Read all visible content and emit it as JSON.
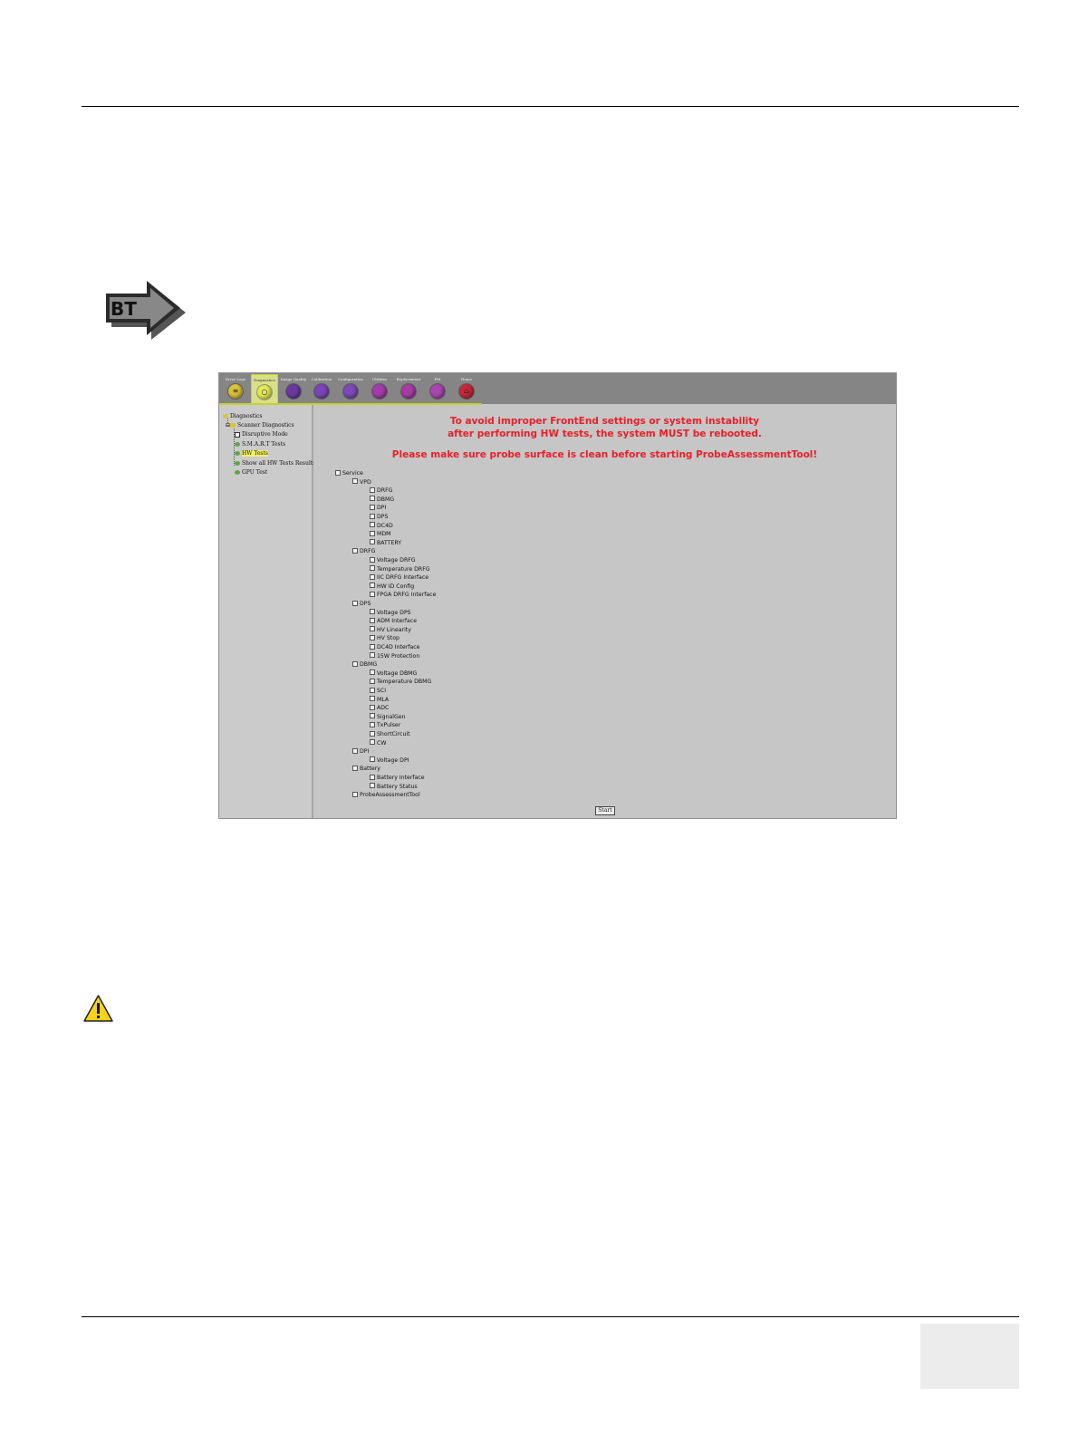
{
  "window": {
    "tabs": [
      {
        "label": "Error Logs",
        "color": "#d9c23a",
        "glyph": "≡"
      },
      {
        "label": "Diagnostics",
        "color": "#e3e85a",
        "glyph": "○"
      },
      {
        "label": "Image Quality",
        "color": "#6a3aa0",
        "glyph": ""
      },
      {
        "label": "Calibration",
        "color": "#7a44b8",
        "glyph": ""
      },
      {
        "label": "Configuration",
        "color": "#7b4ab6",
        "glyph": ""
      },
      {
        "label": "Utilities",
        "color": "#a23ca8",
        "glyph": ""
      },
      {
        "label": "Replacement",
        "color": "#a63ca4",
        "glyph": ""
      },
      {
        "label": "PM",
        "color": "#a845b0",
        "glyph": ""
      },
      {
        "label": "Home",
        "color": "#c8283a",
        "glyph": "⌂"
      }
    ],
    "tree": {
      "root": "Diagnostics",
      "scanner": "Scanner Diagnostics",
      "items": [
        "Disruptive Mode",
        "S.M.A.R.T Tests",
        "HW Tests",
        "Show all HW Tests Results",
        "GPU Test"
      ]
    },
    "warning": {
      "line1": "To avoid improper FrontEnd settings or system instability",
      "line2": "after performing HW tests, the system MUST be rebooted.",
      "line3": "Please make sure probe surface is clean before starting ProbeAssessmentTool!"
    },
    "checklist": [
      {
        "label": "Service",
        "level": 0
      },
      {
        "label": "VPD",
        "level": 1
      },
      {
        "label": "DRFG",
        "level": 2
      },
      {
        "label": "DBMG",
        "level": 2
      },
      {
        "label": "DPI",
        "level": 2
      },
      {
        "label": "DPS",
        "level": 2
      },
      {
        "label": "DC4D",
        "level": 2
      },
      {
        "label": "MDM",
        "level": 2
      },
      {
        "label": "BATTERY",
        "level": 2
      },
      {
        "label": "DRFG",
        "level": 1
      },
      {
        "label": "Voltage DRFG",
        "level": 2
      },
      {
        "label": "Temperature DRFG",
        "level": 2
      },
      {
        "label": "IIC DRFG Interface",
        "level": 2
      },
      {
        "label": "HW ID Config",
        "level": 2
      },
      {
        "label": "FPGA DRFG Interface",
        "level": 2
      },
      {
        "label": "DPS",
        "level": 1
      },
      {
        "label": "Voltage DPS",
        "level": 2
      },
      {
        "label": "ADM Interface",
        "level": 2
      },
      {
        "label": "HV Linearity",
        "level": 2
      },
      {
        "label": "HV Stop",
        "level": 2
      },
      {
        "label": "DC4D Interface",
        "level": 2
      },
      {
        "label": "15W Protection",
        "level": 2
      },
      {
        "label": "DBMG",
        "level": 1
      },
      {
        "label": "Voltage DBMG",
        "level": 2
      },
      {
        "label": "Temperature DBMG",
        "level": 2
      },
      {
        "label": "SCI",
        "level": 2
      },
      {
        "label": "MLA",
        "level": 2
      },
      {
        "label": "ADC",
        "level": 2
      },
      {
        "label": "SignalGen",
        "level": 2
      },
      {
        "label": "TxPulser",
        "level": 2
      },
      {
        "label": "ShortCircuit",
        "level": 2
      },
      {
        "label": "CW",
        "level": 2
      },
      {
        "label": "DPI",
        "level": 1
      },
      {
        "label": "Voltage DPI",
        "level": 2
      },
      {
        "label": "Battery",
        "level": 1
      },
      {
        "label": "Battery Interface",
        "level": 2
      },
      {
        "label": "Battery Status",
        "level": 2
      },
      {
        "label": "ProbeAssessmentTool",
        "level": 1
      }
    ],
    "start_label": "Start"
  },
  "bt_icon": {
    "label": "BT",
    "name": "bt-arrow-icon"
  },
  "caution_icon": {
    "name": "caution-icon"
  }
}
